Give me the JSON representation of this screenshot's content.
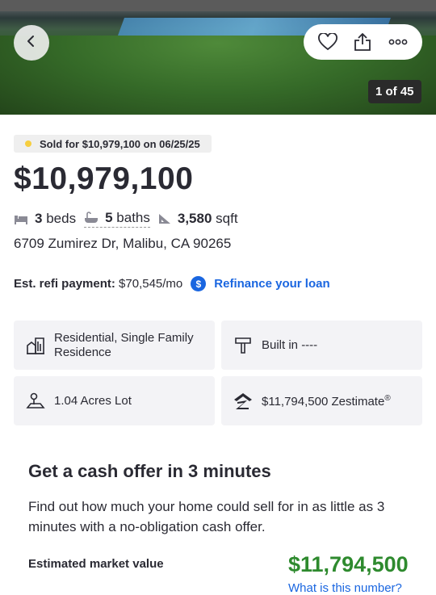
{
  "header": {
    "photo_count": "1 of 45",
    "icons": [
      "chevron-left-icon",
      "heart-icon",
      "share-icon",
      "more-icon"
    ]
  },
  "listing": {
    "status_text": "Sold for $10,979,100 on 06/25/25",
    "status_color": "#f6ce3f",
    "price": "$10,979,100",
    "beds_count": "3",
    "beds_label": "beds",
    "baths_count": "5",
    "baths_label": "baths",
    "sqft_count": "3,580",
    "sqft_label": "sqft",
    "address": "6709 Zumirez Dr, Malibu, CA 90265"
  },
  "refi": {
    "label": "Est. refi payment:",
    "value": "$70,545/mo",
    "icon_glyph": "$",
    "link_text": "Refinance your loan"
  },
  "facts": {
    "type": "Residential, Single Family Residence",
    "built": "Built in ----",
    "lot": "1.04 Acres Lot",
    "zestimate": "$11,794,500 Zestimate",
    "zestimate_mark": "®"
  },
  "cash_offer": {
    "title": "Get a cash offer in 3 minutes",
    "description": "Find out how much your home could sell for in as little as 3 minutes with a no-obligation cash offer.",
    "emv_label": "Estimated market value",
    "emv_value": "$11,794,500",
    "emv_link": "What is this number?"
  },
  "colors": {
    "accent_blue": "#1a66e0",
    "value_green": "#2e8a2e"
  }
}
